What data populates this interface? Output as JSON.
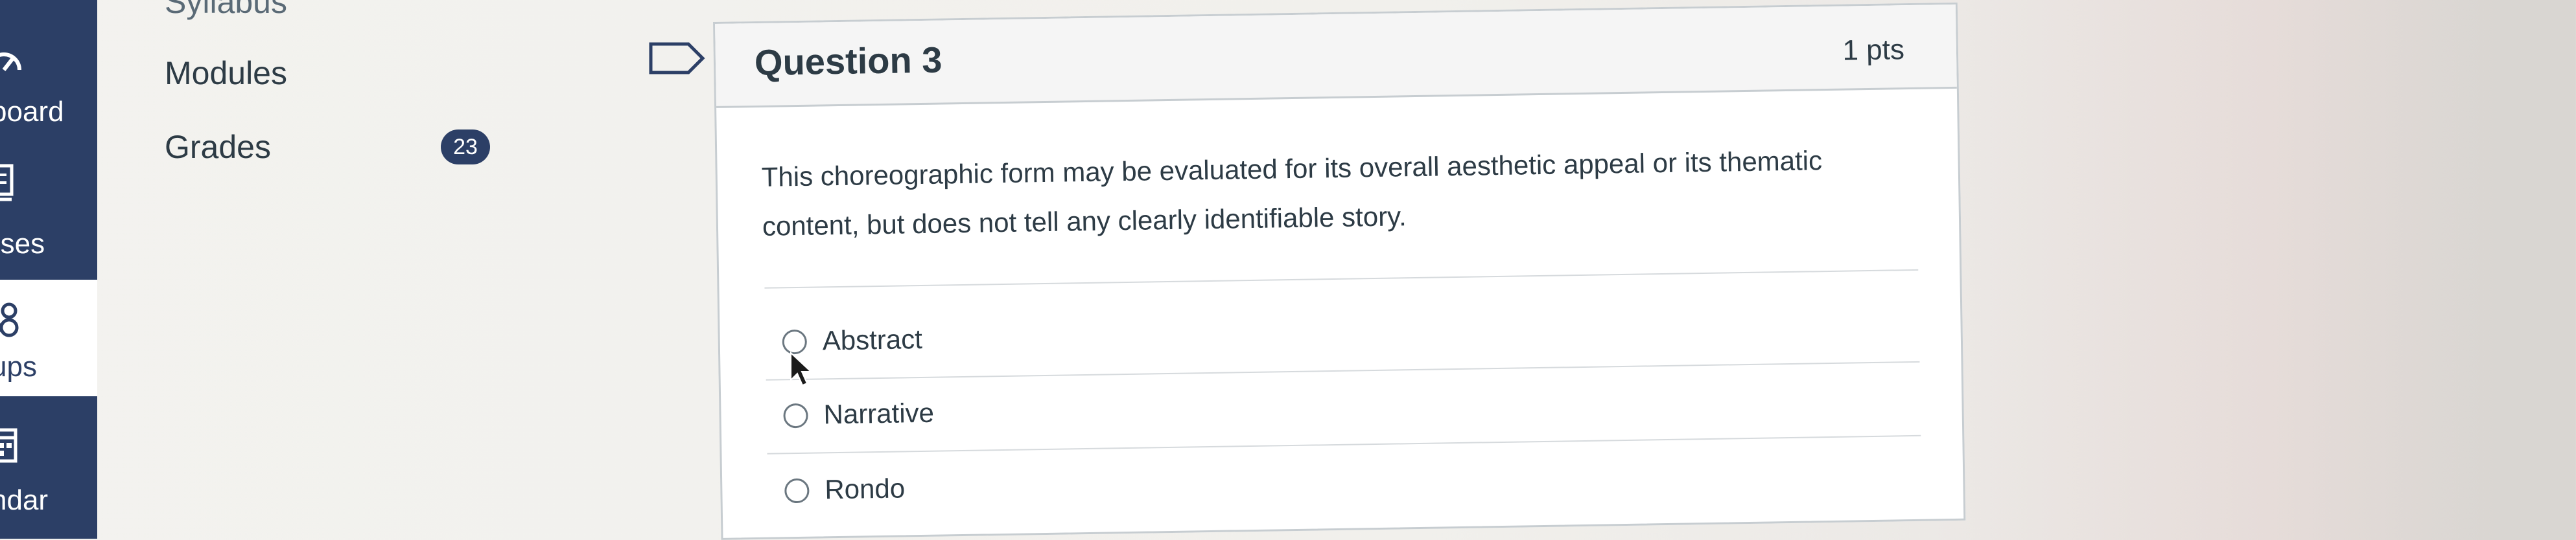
{
  "global_nav": {
    "items": [
      {
        "label": "board",
        "icon": "dashboard-icon",
        "active": false
      },
      {
        "label": "rses",
        "icon": "courses-icon",
        "active": false
      },
      {
        "label": "ups",
        "icon": "groups-icon",
        "active": true
      },
      {
        "label": "ndar",
        "icon": "calendar-icon",
        "active": false
      }
    ]
  },
  "course_nav": {
    "items": [
      {
        "label": "Syllabus"
      },
      {
        "label": "Modules"
      },
      {
        "label": "Grades",
        "badge": "23"
      }
    ]
  },
  "question": {
    "title": "Question 3",
    "points": "1 pts",
    "text_line1": "This choreographic form may be evaluated for its overall aesthetic appeal or its thematic",
    "text_line2": "content, but does not tell any clearly identifiable story.",
    "answers": [
      {
        "label": "Abstract"
      },
      {
        "label": "Narrative"
      },
      {
        "label": "Rondo"
      }
    ]
  },
  "colors": {
    "nav_bg": "#2c3f66",
    "text": "#2d3b45",
    "border": "#c7cdd1"
  }
}
